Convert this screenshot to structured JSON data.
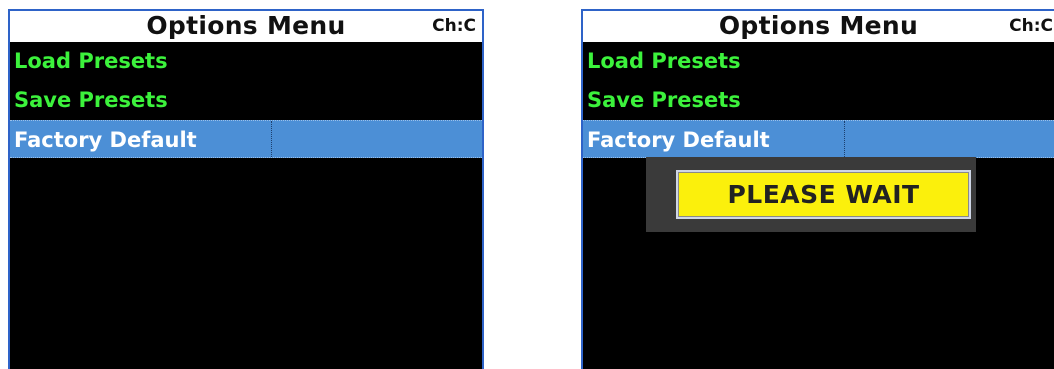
{
  "panels": [
    {
      "title": "Options Menu",
      "channel": "Ch:C",
      "menu": [
        "Load Presets",
        "Save Presets",
        "Factory Default"
      ],
      "selected_index": 2
    },
    {
      "title": "Options Menu",
      "channel": "Ch:C",
      "menu": [
        "Load Presets",
        "Save Presets",
        "Factory Default"
      ],
      "selected_index": 2,
      "dialog": {
        "message": "PLEASE WAIT"
      }
    }
  ],
  "colors": {
    "menu_text": "#3cf23c",
    "selected_bg": "#4c8fd6",
    "screen_bg": "#000000",
    "title_bg": "#ffffff",
    "dialog_bg": "#fbf00c"
  }
}
